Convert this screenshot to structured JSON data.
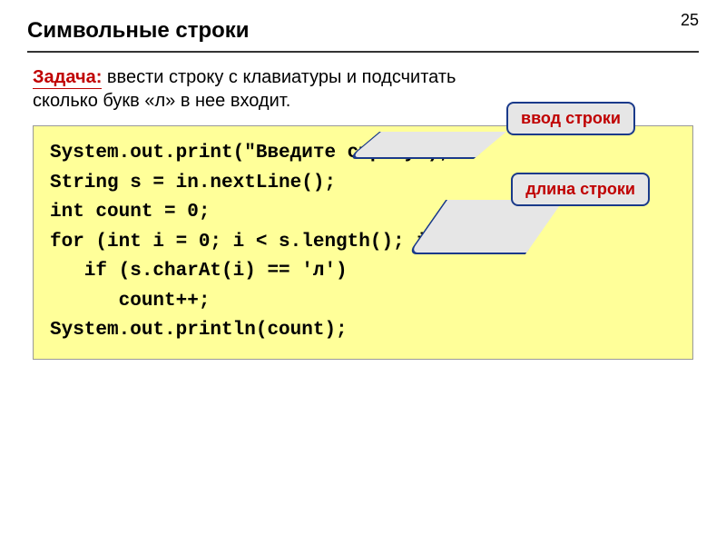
{
  "page_number": "25",
  "title": "Символьные строки",
  "task": {
    "label": "Задача:",
    "text": " ввести строку с клавиатуры и подсчитать сколько букв «л» в нее входит."
  },
  "callouts": {
    "input": "ввод строки",
    "length": "длина строки"
  },
  "code": "System.out.print(\"Введите строку\");\nString s = in.nextLine();\nint count = 0;\nfor (int i = 0; i < s.length(); i++)\n   if (s.charAt(i) == 'л')\n      count++;\nSystem.out.println(count);"
}
